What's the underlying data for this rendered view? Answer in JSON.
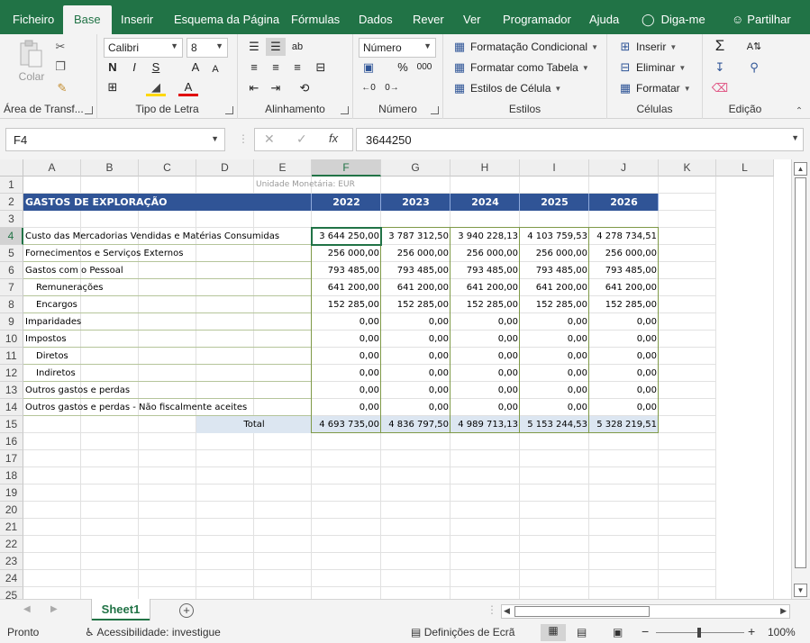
{
  "ribbon_tabs": [
    "Ficheiro",
    "Base",
    "Inserir",
    "Esquema da Página",
    "Fórmulas",
    "Dados",
    "Rever",
    "Ver",
    "Programador",
    "Ajuda",
    "Diga-me",
    "Partilhar"
  ],
  "active_tab": "Base",
  "groups": {
    "clipboard": {
      "label": "Área de Transf...",
      "paste": "Colar"
    },
    "font": {
      "label": "Tipo de Letra",
      "name": "Calibri",
      "size": "8",
      "bold": "N",
      "italic": "I",
      "underline": "S",
      "grow": "A",
      "shrink": "A"
    },
    "alignment": {
      "label": "Alinhamento"
    },
    "number": {
      "label": "Número",
      "format": "Número",
      "percent": "%",
      "thousands": "000"
    },
    "styles": {
      "label": "Estilos",
      "conditional": "Formatação Condicional",
      "as_table": "Formatar como Tabela",
      "cell_styles": "Estilos de Célula"
    },
    "cells": {
      "label": "Células",
      "insert": "Inserir",
      "delete": "Eliminar",
      "format": "Formatar"
    },
    "editing": {
      "label": "Edição"
    }
  },
  "formula_bar": {
    "name_box": "F4",
    "fx": "fx",
    "value": "3644250"
  },
  "columns": [
    "A",
    "B",
    "C",
    "D",
    "E",
    "F",
    "G",
    "H",
    "I",
    "J",
    "K",
    "L"
  ],
  "rows": [
    "1",
    "2",
    "3",
    "4",
    "5",
    "6",
    "7",
    "8",
    "9",
    "10",
    "11",
    "12",
    "13",
    "14",
    "15",
    "16",
    "17",
    "18",
    "19",
    "20",
    "21",
    "22",
    "23",
    "24",
    "25"
  ],
  "sheet": {
    "currency_note": "Unidade Monetária: EUR",
    "title": "GASTOS DE EXPLORAÇÃO",
    "years": [
      "2022",
      "2023",
      "2024",
      "2025",
      "2026"
    ],
    "lines": [
      {
        "label": "Custo das Mercadorias Vendidas  e Matérias Consumidas",
        "values": [
          "3 644 250,00",
          "3 787 312,50",
          "3 940 228,13",
          "4 103 759,53",
          "4 278 734,51"
        ]
      },
      {
        "label": "Fornecimentos e Serviços Externos",
        "values": [
          "256 000,00",
          "256 000,00",
          "256 000,00",
          "256 000,00",
          "256 000,00"
        ]
      },
      {
        "label": "Gastos com o Pessoal",
        "values": [
          "793 485,00",
          "793 485,00",
          "793 485,00",
          "793 485,00",
          "793 485,00"
        ]
      },
      {
        "label": "Remunerações",
        "values": [
          "641 200,00",
          "641 200,00",
          "641 200,00",
          "641 200,00",
          "641 200,00"
        ]
      },
      {
        "label": "Encargos",
        "values": [
          "152 285,00",
          "152 285,00",
          "152 285,00",
          "152 285,00",
          "152 285,00"
        ]
      },
      {
        "label": "Imparidades",
        "values": [
          "0,00",
          "0,00",
          "0,00",
          "0,00",
          "0,00"
        ]
      },
      {
        "label": "Impostos",
        "values": [
          "0,00",
          "0,00",
          "0,00",
          "0,00",
          "0,00"
        ]
      },
      {
        "label": "Diretos",
        "values": [
          "0,00",
          "0,00",
          "0,00",
          "0,00",
          "0,00"
        ]
      },
      {
        "label": "Indiretos",
        "values": [
          "0,00",
          "0,00",
          "0,00",
          "0,00",
          "0,00"
        ]
      },
      {
        "label": "Outros gastos e perdas",
        "values": [
          "0,00",
          "0,00",
          "0,00",
          "0,00",
          "0,00"
        ]
      },
      {
        "label": "Outros gastos e perdas - Não fiscalmente aceites",
        "values": [
          "0,00",
          "0,00",
          "0,00",
          "0,00",
          "0,00"
        ]
      }
    ],
    "total_label": "Total",
    "totals": [
      "4 693 735,00",
      "4 836 797,50",
      "4 989 713,13",
      "5 153 244,53",
      "5 328 219,51"
    ]
  },
  "sheet_tab": "Sheet1",
  "status": {
    "ready": "Pronto",
    "accessibility": "Acessibilidade: investigue",
    "display_settings": "Definições de Ecrã",
    "zoom": "100%"
  }
}
